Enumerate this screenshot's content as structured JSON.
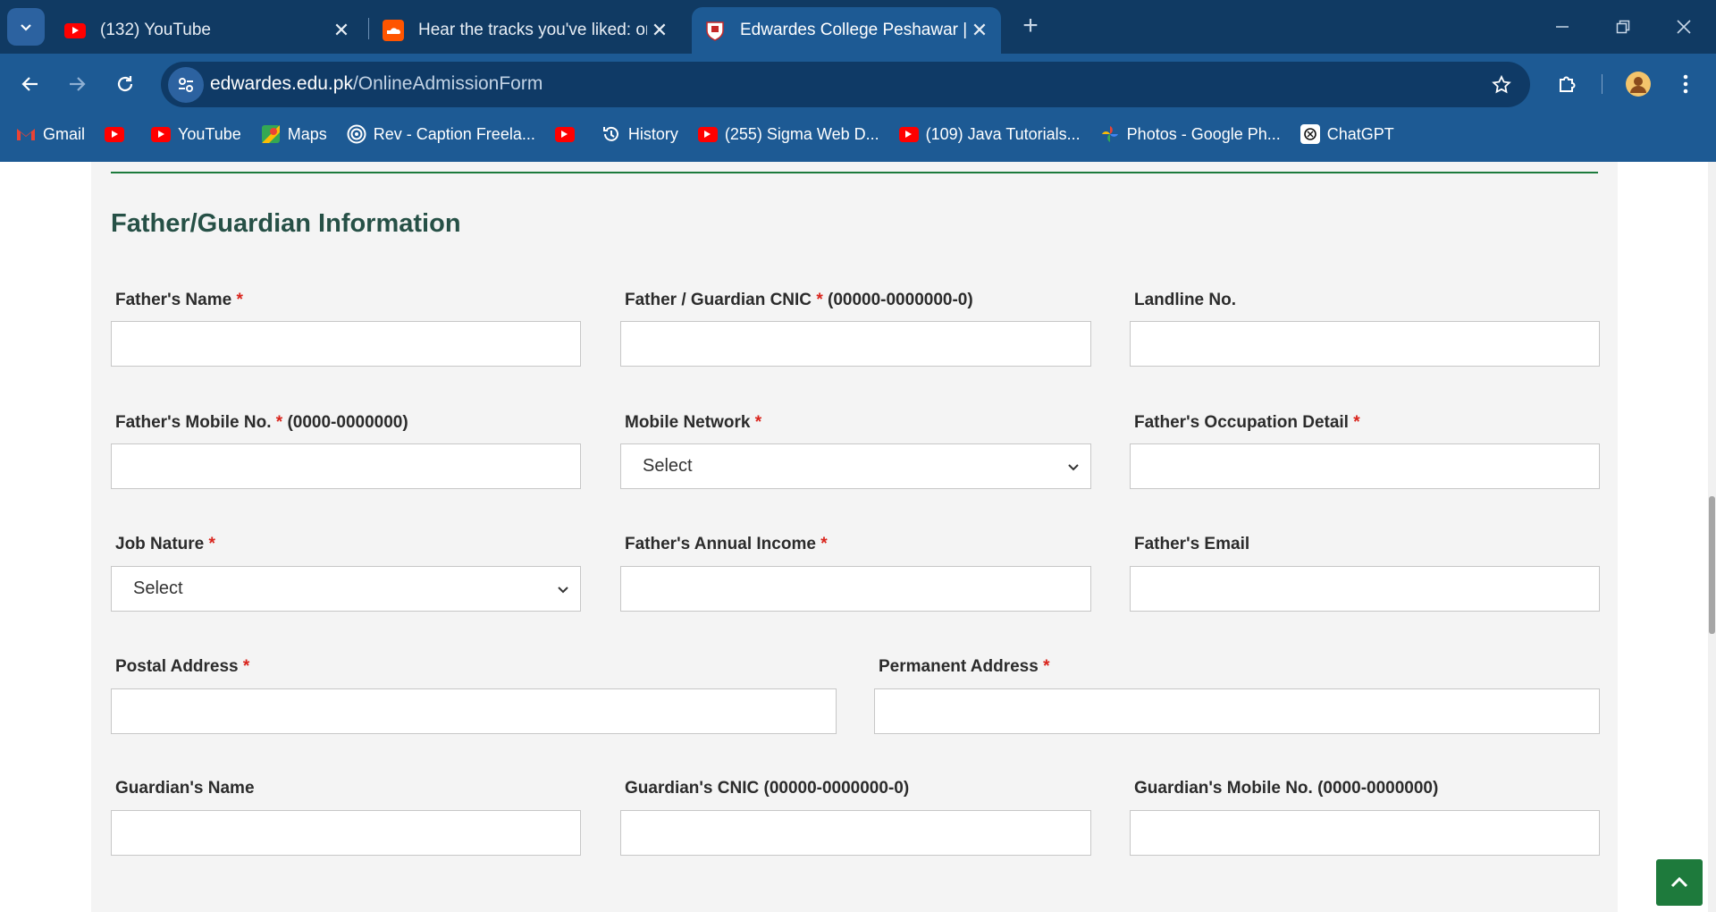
{
  "tabs": [
    {
      "title": "(132) YouTube",
      "icon": "youtube-icon"
    },
    {
      "title": "Hear the tracks you've liked: on",
      "icon": "soundcloud-icon"
    },
    {
      "title": "Edwardes College Peshawar | EC",
      "icon": "college-crest-icon"
    }
  ],
  "address_bar": {
    "domain": "edwardes.edu.pk",
    "path": "/OnlineAdmissionForm"
  },
  "bookmarks": [
    {
      "label": "Gmail",
      "icon": "gmail-icon"
    },
    {
      "label": "",
      "icon": "youtube-icon"
    },
    {
      "label": "YouTube",
      "icon": "youtube-icon"
    },
    {
      "label": "Maps",
      "icon": "maps-icon"
    },
    {
      "label": "Rev - Caption Freela...",
      "icon": "rev-icon"
    },
    {
      "label": "",
      "icon": "youtube-icon"
    },
    {
      "label": "History",
      "icon": "history-icon"
    },
    {
      "label": "(255) Sigma Web D...",
      "icon": "youtube-icon"
    },
    {
      "label": "(109) Java Tutorials...",
      "icon": "youtube-icon"
    },
    {
      "label": "Photos - Google Ph...",
      "icon": "google-photos-icon"
    },
    {
      "label": "ChatGPT",
      "icon": "chatgpt-icon"
    }
  ],
  "form": {
    "section_title": "Father/Guardian Information",
    "required_mark": "*",
    "select_default": "Select",
    "fathers_name": {
      "label": "Father's Name",
      "value": ""
    },
    "father_cnic": {
      "label": "Father / Guardian CNIC",
      "hint": "(00000-0000000-0)",
      "value": ""
    },
    "landline": {
      "label": "Landline No.",
      "value": ""
    },
    "father_mobile": {
      "label": "Father's Mobile No.",
      "hint": "(0000-0000000)",
      "value": ""
    },
    "mobile_network": {
      "label": "Mobile Network",
      "value": "Select"
    },
    "occupation": {
      "label": "Father's Occupation Detail",
      "value": ""
    },
    "job_nature": {
      "label": "Job Nature",
      "value": "Select"
    },
    "annual_income": {
      "label": "Father's Annual Income",
      "value": ""
    },
    "father_email": {
      "label": "Father's Email",
      "value": ""
    },
    "postal_address": {
      "label": "Postal Address",
      "value": ""
    },
    "permanent_address": {
      "label": "Permanent Address",
      "value": ""
    },
    "guardian_name": {
      "label": "Guardian's Name",
      "value": ""
    },
    "guardian_cnic": {
      "label": "Guardian's CNIC (00000-0000000-0)",
      "value": ""
    },
    "guardian_mobile": {
      "label": "Guardian's Mobile No. (0000-0000000)",
      "value": ""
    }
  },
  "colors": {
    "accent_green": "#1e7a3c",
    "heading": "#265046",
    "required": "#d9241c",
    "chrome_blue": "#1d5a94"
  }
}
